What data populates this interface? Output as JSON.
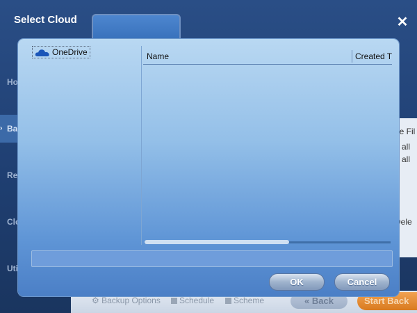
{
  "dialog": {
    "title": "Select Cloud",
    "close_glyph": "✕",
    "ok_label": "OK",
    "cancel_label": "Cancel",
    "path_value": ""
  },
  "tree": {
    "items": [
      {
        "label": "OneDrive",
        "icon": "onedrive-cloud-icon"
      }
    ]
  },
  "file_list": {
    "columns": [
      "Name",
      "Created T"
    ],
    "rows": []
  },
  "background_app": {
    "nav_items": [
      "Ho",
      "Ba",
      "Re",
      "Clo",
      "Uti"
    ],
    "right_texts": [
      "de Fil",
      "p all",
      "p all",
      "Dele"
    ],
    "footer": {
      "backup_options": "Backup Options",
      "schedule": "Schedule",
      "scheme": "Scheme",
      "back": "Back",
      "start_backup": "Start Back"
    }
  },
  "colors": {
    "panel_top": "#b9d8f2",
    "panel_bottom": "#4b7fc6",
    "app_bg": "#1f3f72",
    "start_button": "#e08a2e"
  }
}
